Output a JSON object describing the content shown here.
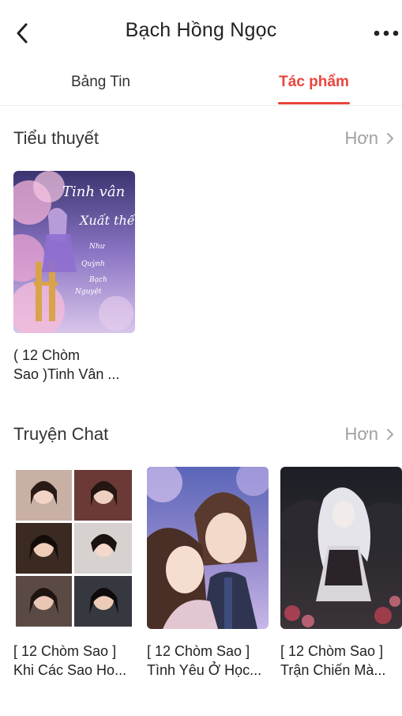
{
  "header": {
    "title": "Bạch Hồng Ngọc",
    "back_icon": "chevron-left-icon",
    "more_icon": "more-dots-icon"
  },
  "tabs": [
    {
      "label": "Bảng Tin",
      "active": false
    },
    {
      "label": "Tác phẩm",
      "active": true
    }
  ],
  "accent_color": "#e8453c",
  "novels": {
    "title": "Tiểu thuyết",
    "more_label": "Hơn",
    "items": [
      {
        "line1": "( 12 Chòm",
        "line2": "Sao )Tinh Vân ..."
      }
    ]
  },
  "chat_stories": {
    "title": "Truyện Chat",
    "more_label": "Hơn",
    "items": [
      {
        "line1": "[ 12 Chòm Sao ]",
        "line2": "Khi Các Sao Ho..."
      },
      {
        "line1": "[ 12 Chòm Sao ]",
        "line2": "Tình Yêu Ở Học..."
      },
      {
        "line1": "[ 12 Chòm Sao ]",
        "line2": "Trận Chiến Mà..."
      }
    ]
  }
}
